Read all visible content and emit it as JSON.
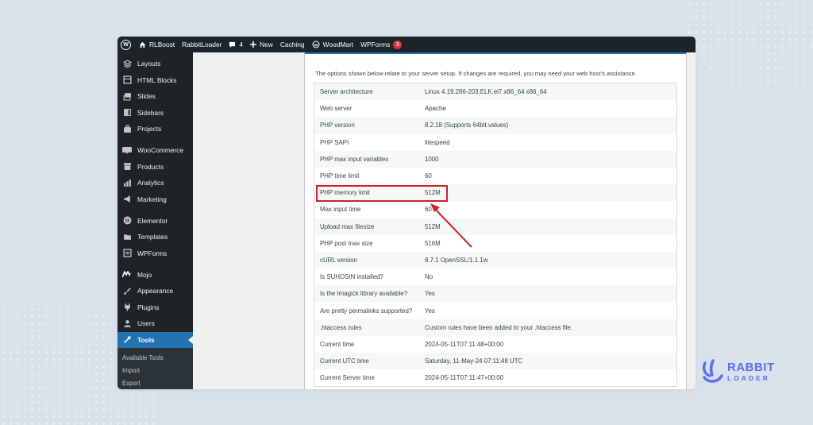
{
  "admin_bar": {
    "site_name": "RLBoost",
    "plugin": "RabbitLoader",
    "comments_count": "4",
    "new_label": "New",
    "caching_label": "Caching",
    "woodmart_label": "WoodMart",
    "wpforms_label": "WPForms",
    "wpforms_badge": "3"
  },
  "sidebar": {
    "items": [
      {
        "label": "Layouts",
        "icon": "layers-icon"
      },
      {
        "label": "HTML Blocks",
        "icon": "blocks-icon"
      },
      {
        "label": "Slides",
        "icon": "slides-icon"
      },
      {
        "label": "Sidebars",
        "icon": "sidebars-icon"
      },
      {
        "label": "Projects",
        "icon": "briefcase-icon"
      },
      {
        "label": "WooCommerce",
        "icon": "woo-icon"
      },
      {
        "label": "Products",
        "icon": "archive-icon"
      },
      {
        "label": "Analytics",
        "icon": "bar-chart-icon"
      },
      {
        "label": "Marketing",
        "icon": "megaphone-icon"
      },
      {
        "label": "Elementor",
        "icon": "elementor-icon"
      },
      {
        "label": "Templates",
        "icon": "folder-icon"
      },
      {
        "label": "WPForms",
        "icon": "wpforms-icon"
      },
      {
        "label": "Mojo",
        "icon": "mojo-icon"
      },
      {
        "label": "Appearance",
        "icon": "brush-icon"
      },
      {
        "label": "Plugins",
        "icon": "plug-icon"
      },
      {
        "label": "Users",
        "icon": "user-icon"
      },
      {
        "label": "Tools",
        "icon": "wrench-icon"
      }
    ],
    "submenu": [
      "Available Tools",
      "Import",
      "Export"
    ]
  },
  "content": {
    "intro": "The options shown below relate to your server setup. If changes are required, you may need your web host's assistance.",
    "rows": [
      {
        "key": "Server architecture",
        "value": "Linux 4.19.286-203.ELK.el7.x86_64 x86_64"
      },
      {
        "key": "Web server",
        "value": "Apache"
      },
      {
        "key": "PHP version",
        "value": "8.2.18 (Supports 64bit values)"
      },
      {
        "key": "PHP SAPI",
        "value": "litespeed"
      },
      {
        "key": "PHP max input variables",
        "value": "1000"
      },
      {
        "key": "PHP time limit",
        "value": "60"
      },
      {
        "key": "PHP memory limit",
        "value": "512M"
      },
      {
        "key": "Max input time",
        "value": "60"
      },
      {
        "key": "Upload max filesize",
        "value": "512M"
      },
      {
        "key": "PHP post max size",
        "value": "516M"
      },
      {
        "key": "cURL version",
        "value": "8.7.1 OpenSSL/1.1.1w"
      },
      {
        "key": "Is SUHOSIN installed?",
        "value": "No"
      },
      {
        "key": "Is the Imagick library available?",
        "value": "Yes"
      },
      {
        "key": "Are pretty permalinks supported?",
        "value": "Yes"
      },
      {
        "key": ".htaccess rules",
        "value": "Custom rules have been added to your .htaccess file."
      },
      {
        "key": "Current time",
        "value": "2024-05-11T07:11:48+00:00"
      },
      {
        "key": "Current UTC time",
        "value": "Saturday, 11-May-24 07:11:48 UTC"
      },
      {
        "key": "Current Server time",
        "value": "2024-05-11T07:11:47+00:00"
      }
    ]
  },
  "brand": {
    "line1": "RABBIT",
    "line2": "LOADER"
  },
  "colors": {
    "accent": "#2271b1",
    "highlight": "#d0202a",
    "brand": "#5b6ef5"
  }
}
